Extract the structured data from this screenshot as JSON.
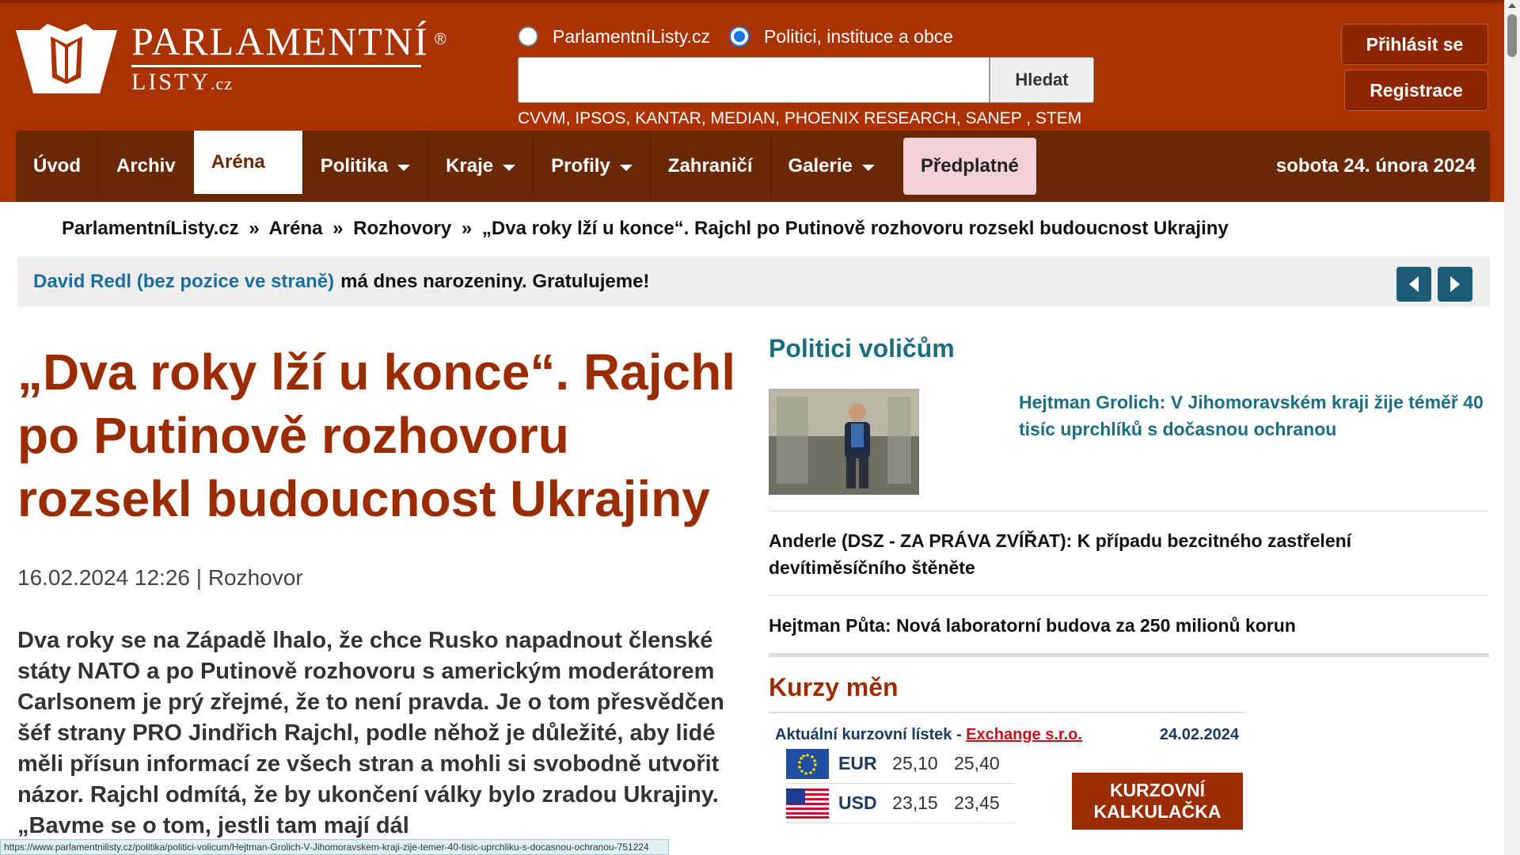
{
  "site": {
    "logo_main": "PARLAMENTNÍ",
    "logo_reg": "®",
    "logo_sub": "LISTY",
    "logo_tld": ".cz"
  },
  "search": {
    "option1": "ParlamentníListy.cz",
    "option2": "Politici, instituce a obce",
    "selected": "option2",
    "value": "",
    "button": "Hledat",
    "agencies": "CVVM, IPSOS, KANTAR, MEDIAN, PHOENIX RESEARCH, SANEP , STEM"
  },
  "auth": {
    "login": "Přihlásit se",
    "register": "Registrace"
  },
  "nav": {
    "items": [
      "Úvod",
      "Archiv",
      "Aréna",
      "Politika",
      "Kraje",
      "Profily",
      "Zahraničí",
      "Galerie"
    ],
    "active": "Aréna",
    "subscription": "Předplatné",
    "date": "sobota 24. února 2024"
  },
  "breadcrumb": {
    "items": [
      "ParlamentníListy.cz",
      "Aréna",
      "Rozhovory",
      "„Dva roky lží u konce“. Rajchl po Putinově rozhovoru rozsekl budoucnost Ukrajiny"
    ],
    "separator": "»"
  },
  "birthday": {
    "name": "David Redl (bez pozice ve straně)",
    "text": "má dnes narozeniny. Gratulujeme!"
  },
  "article": {
    "title": "„Dva roky lží u konce“. Rajchl po Putinově rozhovoru rozsekl budoucnost Ukrajiny",
    "meta": "16.02.2024 12:26 | Rozhovor",
    "lead": "Dva roky se na Západě lhalo, že chce Rusko napadnout členské státy NATO a po Putinově rozhovoru s americkým moderátorem Carlsonem je prý zřejmé, že to není pravda. Je o tom přesvědčen šéf strany PRO Jindřich Rajchl, podle něhož je důležité, aby lidé měli přísun informací ze všech stran a mohli si svobodně utvořit názor. Rajchl odmítá, že by ukončení války bylo zradou Ukrajiny. „Bavme se o tom, jestli tam mají dál"
  },
  "sidebar": {
    "heading": "Politici voličům",
    "feature_title": "Hejtman Grolich: V Jihomoravském kraji žije téměř 40 tisíc uprchlíků s dočasnou ochranou",
    "items": [
      "Anderle (DSZ - ZA PRÁVA ZVÍŘAT): K případu bezcitného zastřelení devítiměsíčního štěněte",
      "Hejtman Půta: Nová laboratorní budova za 250 milionů korun"
    ]
  },
  "rates": {
    "heading": "Kurzy měn",
    "label": "Aktuální kurzovní lístek -",
    "provider": "Exchange s.r.o.",
    "date": "24.02.2024",
    "rows": [
      {
        "code": "EUR",
        "buy": "25,10",
        "sell": "25,40"
      },
      {
        "code": "USD",
        "buy": "23,15",
        "sell": "23,45"
      }
    ],
    "calc_button": "KURZOVNÍ KALKULAČKA"
  },
  "status": {
    "url": "https://www.parlamentnilisty.cz/politika/politici-volicum/Hejtman-Grolich-V-Jihomoravskem-kraji-zije-temer-40-tisic-uprchliku-s-docasnou-ochranou-751224"
  },
  "colors": {
    "header": "#aa3200",
    "nav": "#6a2807",
    "title": "#9b2c00",
    "link": "#1b6e80"
  }
}
